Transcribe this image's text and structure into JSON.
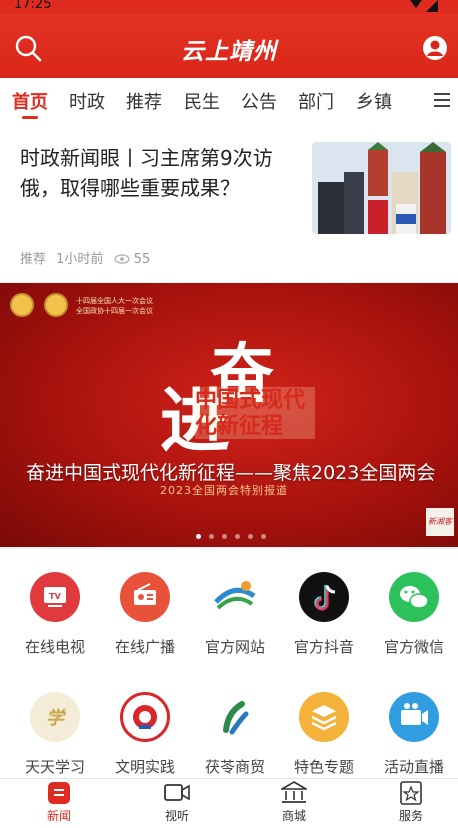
{
  "status_bar": {
    "time": "17:25"
  },
  "header": {
    "title": "云上靖州"
  },
  "tabs": [
    {
      "label": "首页",
      "active": true
    },
    {
      "label": "时政"
    },
    {
      "label": "推荐"
    },
    {
      "label": "民生"
    },
    {
      "label": "公告"
    },
    {
      "label": "部门"
    },
    {
      "label": "乡镇"
    }
  ],
  "news_item": {
    "headline": "时政新闻眼丨习主席第9次访俄，取得哪些重要成果？",
    "category": "推荐",
    "time": "1小时前",
    "views": "55"
  },
  "banner": {
    "emblem_text_line1": "十四届全国人大一次会议",
    "emblem_text_line2": "全国政协十四届一次会议",
    "art_char_1": "进",
    "art_char_2": "奋",
    "art_slogan": "中国式现代化新征程",
    "art_subtitle": "2023全国两会特别报道",
    "caption": "奋进中国式现代化新征程——聚焦2023全国两会",
    "slide_count": 6,
    "active_slide": 1,
    "stamp_text": "新湘客"
  },
  "shortcuts": [
    {
      "label": "在线电视",
      "icon": "tv-icon",
      "color": "#e0393e"
    },
    {
      "label": "在线广播",
      "icon": "radio-icon",
      "color": "#e8523a"
    },
    {
      "label": "官方网站",
      "icon": "website-logo-icon",
      "color": "#2a8bd0"
    },
    {
      "label": "官方抖音",
      "icon": "douyin-icon",
      "color": "#111111"
    },
    {
      "label": "官方微信",
      "icon": "wechat-icon",
      "color": "#2dc15c"
    },
    {
      "label": "天天学习",
      "icon": "study-icon",
      "color": "#c9a64a"
    },
    {
      "label": "文明实践",
      "icon": "civilization-icon",
      "color": "#d8262b"
    },
    {
      "label": "茯苓商贸",
      "icon": "commerce-icon",
      "color": "#2e8a4a"
    },
    {
      "label": "特色专题",
      "icon": "layers-icon",
      "color": "#f4b23a"
    },
    {
      "label": "活动直播",
      "icon": "live-video-icon",
      "color": "#2f9de0"
    }
  ],
  "bottom_nav": [
    {
      "label": "新闻",
      "icon": "news-icon",
      "active": true
    },
    {
      "label": "视听",
      "icon": "video-icon"
    },
    {
      "label": "商城",
      "icon": "mall-icon"
    },
    {
      "label": "服务",
      "icon": "service-icon"
    }
  ],
  "colors": {
    "brand": "#e02b20"
  }
}
